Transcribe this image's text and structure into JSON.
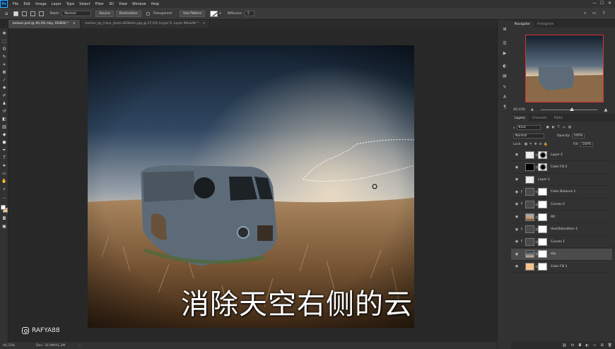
{
  "menubar": {
    "logo": "Ps",
    "items": [
      "File",
      "Edit",
      "Image",
      "Layer",
      "Type",
      "Select",
      "Filter",
      "3D",
      "View",
      "Window",
      "Help"
    ]
  },
  "options": {
    "patch_label": "Patch:",
    "patch_value": "Normal",
    "source": "Source",
    "destination": "Destination",
    "transparent": "Transparent",
    "use_pattern": "Use Pattern",
    "diffusion_label": "Diffusion:",
    "diffusion_value": "5"
  },
  "tabs": [
    {
      "label": "baloon.psd @ 40,3% (sky, RGB/8) *"
    },
    {
      "label": "camion_by_frans_stock-d63bvkn.jpg @ 27,5% (Layer 0, Layer Mask/8) *"
    }
  ],
  "subtitle": "消除天空右侧的云",
  "watermark": "RAFYA88",
  "status": {
    "zoom": "40,33%",
    "doc": "Doc: 10,9M/91,2M"
  },
  "navigator": {
    "tab_active": "Navigator",
    "tab_other": "Histogram",
    "zoom": "40,33%",
    "zoom_level": 0.55
  },
  "layers_panel": {
    "tabs": [
      "Layers",
      "Channels",
      "Paths"
    ],
    "kind": "Kind",
    "blend": "Normal",
    "opacity_label": "Opacity:",
    "opacity": "100%",
    "lock_label": "Lock:",
    "fill_label": "Fill:",
    "fill": "100%"
  },
  "layers": [
    {
      "name": "Layer 2",
      "thumb": "checker",
      "mask": "Layer 2 mask",
      "fx": ""
    },
    {
      "name": "Color Fill 2",
      "thumb": "black",
      "mask": "Color Fill 2 mask",
      "fx": ""
    },
    {
      "name": "Layer 1",
      "thumb": "checker",
      "mask": "",
      "fx": ""
    },
    {
      "name": "Color Balance 1",
      "thumb": "adjust",
      "mask": "Color Balance 1 mask",
      "fx": "f"
    },
    {
      "name": "Curves 2",
      "thumb": "adjust",
      "mask": "Curves 2 mask",
      "fx": "f"
    },
    {
      "name": "RR",
      "thumb": "photo",
      "mask": "RR mask",
      "fx": ""
    },
    {
      "name": "Hue/Saturation 1",
      "thumb": "adjust",
      "mask": "Hue/Saturation 1 mask",
      "fx": "f"
    },
    {
      "name": "Curves 1",
      "thumb": "adjust",
      "mask": "Curves 1 mask",
      "fx": "f"
    },
    {
      "name": "sky",
      "thumb": "sky",
      "mask": "sky mask",
      "fx": ""
    },
    {
      "name": "Color Fill 1",
      "thumb": "peach",
      "mask": "Color Fill 1 mask",
      "fx": ""
    }
  ],
  "selected_layer": "sky",
  "colors": {
    "fg": "#ffffff",
    "bg": "#f6c48a",
    "accent_nav_border": "#e03030"
  }
}
